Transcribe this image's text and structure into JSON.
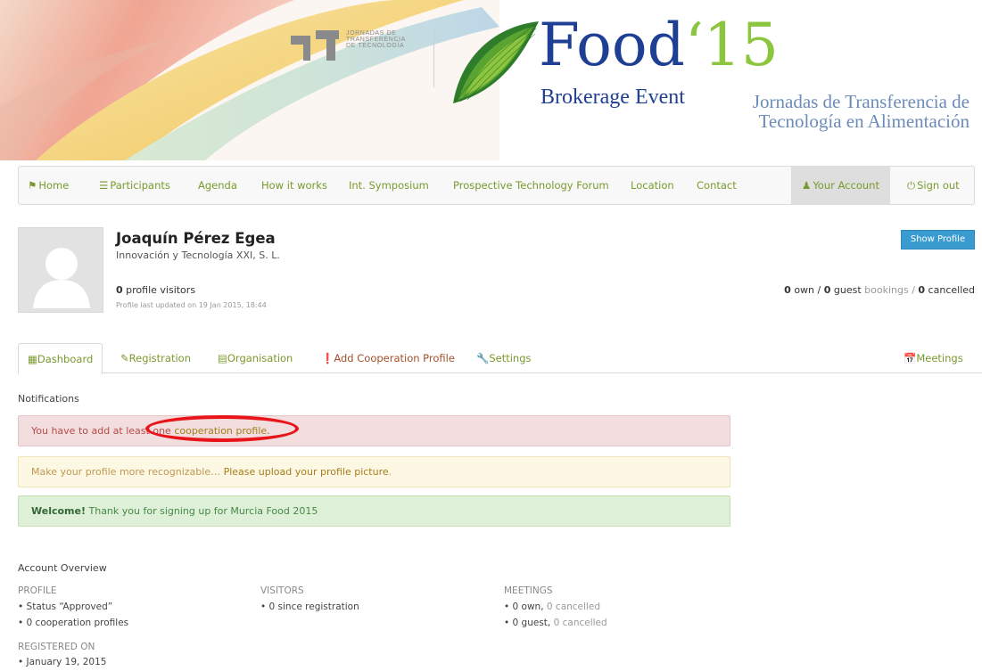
{
  "banner": {
    "jornadas_logo": [
      "JORNADAS DE",
      "TRANSFERENCIA",
      "DE TECNOLOGÍA"
    ],
    "food_title": "Food",
    "food_year": "‘15",
    "brokerage": "Brokerage Event",
    "subtitle_line1": "Jornadas de Transferencia de",
    "subtitle_line2": "Tecnología en Alimentación"
  },
  "nav": {
    "home": "Home",
    "participants": "Participants",
    "agenda": "Agenda",
    "how_it_works": "How it works",
    "symposium": "Int. Symposium",
    "forum": "Prospective Technology Forum",
    "location": "Location",
    "contact": "Contact",
    "your_account": "Your Account",
    "sign_out": "Sign out"
  },
  "profile": {
    "name": "Joaquín Pérez Egea",
    "organisation": "Innovación y Tecnología XXI, S. L.",
    "visitors_count": "0",
    "visitors_label": " profile visitors",
    "last_updated": "Profile last updated on 19 Jan 2015, 18:44",
    "show_profile": "Show Profile",
    "bookings": {
      "own": "0",
      "own_label": " own / ",
      "guest": "0",
      "guest_label": " guest",
      "bookings_word": " bookings / ",
      "cancelled": "0",
      "cancelled_label": " cancelled"
    }
  },
  "tabs": {
    "dashboard": "Dashboard",
    "registration": "Registration",
    "organisation": "Organisation",
    "add_cooperation": "Add Cooperation Profile",
    "settings": "Settings",
    "meetings": "Meetings"
  },
  "notifications": {
    "title": "Notifications",
    "danger_prefix": "You have to add at least one ",
    "danger_link": "cooperation profile",
    "danger_suffix": ".",
    "warning_prefix": "Make your profile more recognizable… ",
    "warning_link": "Please upload your profile picture",
    "warning_suffix": ".",
    "success_bold": "Welcome!",
    "success_text": " Thank you for signing up for Murcia Food 2015"
  },
  "overview": {
    "title": "Account Overview",
    "profile_head": "PROFILE",
    "profile_status": "• Status “Approved”",
    "profile_coop": "• 0 cooperation profiles",
    "registered_head": "REGISTERED ON",
    "registered_date": "• January 19, 2015",
    "visitors_head": "VISITORS",
    "visitors_line": "• 0 since registration",
    "meetings_head": "MEETINGS",
    "meetings_own": "• 0 own, ",
    "meetings_own_cancelled": "0 cancelled",
    "meetings_guest": "• 0 guest, ",
    "meetings_guest_cancelled": "0 cancelled"
  },
  "colors": {
    "accent_green": "#7a9a2e",
    "brand_blue": "#1e3f93",
    "brand_green": "#8cc63f",
    "button_blue": "#3a9bd1",
    "danger": "#b94a48",
    "warning": "#c09853",
    "success": "#468847",
    "annotation_red": "#e8141a"
  }
}
